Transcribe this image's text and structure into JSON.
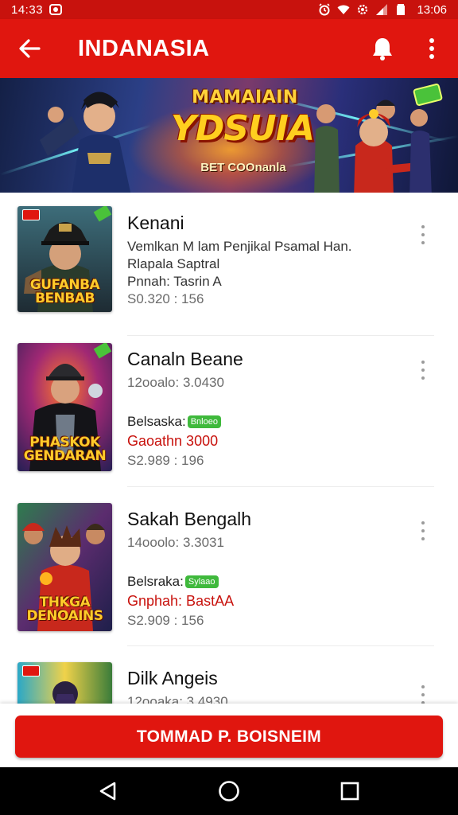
{
  "status_bar": {
    "time_left": "14:33",
    "time_right": "13:06",
    "icons": [
      "app-notification-icon",
      "alarm-icon",
      "wifi-icon",
      "settings-icon",
      "signal-icon",
      "battery-icon"
    ]
  },
  "app_bar": {
    "title": "INDANASIA",
    "icons": [
      "back-arrow-icon",
      "bell-icon",
      "more-vert-icon"
    ]
  },
  "banner": {
    "line1": "MAMAIAIN",
    "line2": "YDSUIA",
    "line3": "BET COOnanla"
  },
  "items": [
    {
      "name": "Kenani",
      "desc": "Vemlkan M lam Penjikal Psamal Han.",
      "line2": "Rlapala Saptral",
      "line3": "Pnnah: Tasrin A",
      "price": "S0.320 : 156",
      "thumb_text": "GUFANBA BENBAB"
    },
    {
      "name": "Canaln Beane",
      "meta": "12ooalo: 3.0430",
      "status_label": "Belsaska:",
      "badge": "Bnloeo",
      "red_text": "Gaoathn 3000",
      "price": "S2.989 : 196",
      "thumb_text": "PHASKOK GENDARAN"
    },
    {
      "name": "Sakah Bengalh",
      "meta": "14ooolo: 3.3031",
      "status_label": "Belsraka:",
      "badge": "Sylaao",
      "red_text": "Gnphah: BastAA",
      "price": "S2.909 : 156",
      "thumb_text": "THKGA DENOAINS"
    },
    {
      "name": "Dilk Angeis",
      "meta": "12ooaka: 3.4930"
    }
  ],
  "cta": {
    "label": "TOMMAD P. BOISNEIM"
  },
  "nav": {
    "icons": [
      "back-triangle-icon",
      "home-circle-icon",
      "recents-square-icon"
    ]
  },
  "colors": {
    "primary_red": "#e0160f",
    "status_red": "#c8120d",
    "badge_green": "#3fb93c"
  }
}
